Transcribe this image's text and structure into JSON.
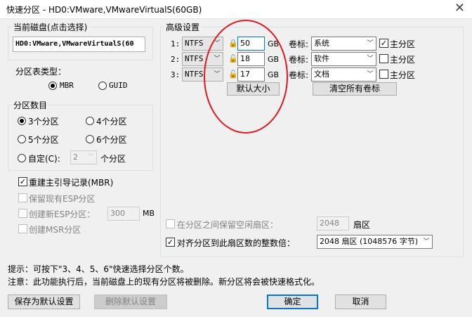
{
  "window": {
    "title": "快速分区 - HD0:VMware,VMwareVirtualS(60GB)",
    "close": "✕"
  },
  "current_disk": {
    "legend": "当前磁盘(点击选择)",
    "value": "HD0:VMware,VMwareVirtualS(60"
  },
  "partition_table": {
    "label": "分区表类型：",
    "options": [
      "MBR",
      "GUID"
    ],
    "selected": "MBR"
  },
  "partition_count": {
    "legend": "分区数目",
    "options": [
      "3个分区",
      "4个分区",
      "5个分区",
      "6个分区",
      "自定(C):"
    ],
    "selected": "3个分区",
    "custom_value": "2",
    "custom_suffix": "个分区"
  },
  "options": {
    "rebuild_mbr": "重建主引导记录(MBR)",
    "keep_esp": "保留现有ESP分区",
    "create_esp": "创建新ESP分区：",
    "esp_size": "300",
    "esp_unit": "MB",
    "create_msr": "创建MSR分区"
  },
  "advanced": {
    "legend": "高级设置",
    "rows": [
      {
        "index": "1:",
        "fs": "NTFS",
        "size": "50",
        "unit": "GB",
        "vol_label_text": "卷标:",
        "vol": "系统",
        "primary": "主分区",
        "primary_checked": true,
        "lock": "locked"
      },
      {
        "index": "2:",
        "fs": "NTFS",
        "size": "18",
        "unit": "GB",
        "vol_label_text": "卷标:",
        "vol": "软件",
        "primary": "主分区",
        "primary_checked": false,
        "lock": "unlocked"
      },
      {
        "index": "3:",
        "fs": "NTFS",
        "size": "17",
        "unit": "GB",
        "vol_label_text": "卷标:",
        "vol": "文档",
        "primary": "主分区",
        "primary_checked": false,
        "lock": "unlocked"
      }
    ],
    "default_size_btn": "默认大小",
    "clear_labels_btn": "清空所有卷标",
    "reserve_sectors": "在分区之间保留空闲扇区：",
    "reserve_value": "2048",
    "reserve_unit": "扇区",
    "align": "对齐分区到此扇区数的整数倍：",
    "align_value": "2048 扇区 (1048576 字节)"
  },
  "hints": {
    "tip": "提示：可按下\"3、4、5、6\"快速选择分区个数。",
    "note": "注意：此功能执行后，当前磁盘上的现有分区将被删除。新分区将会被快速格式化。"
  },
  "footer": {
    "save_default": "保存为默认设置",
    "delete_default": "删除默认设置",
    "ok": "确定",
    "cancel": "取消"
  },
  "colors": {
    "annotation_circle": "#e0191f",
    "accent": "#0078d7"
  }
}
